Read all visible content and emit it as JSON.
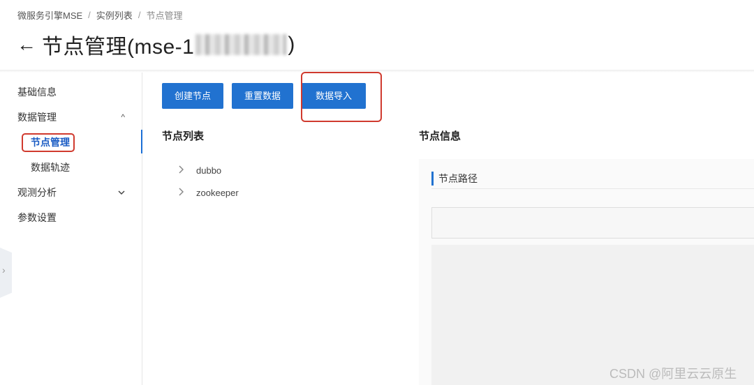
{
  "breadcrumb": {
    "items": [
      "微服务引擎MSE",
      "实例列表",
      "节点管理"
    ],
    "separator": "/"
  },
  "header": {
    "back_icon": "arrow-left-icon",
    "title_prefix": "节点管理(mse-1",
    "title_suffix": ")"
  },
  "sidebar": {
    "items": [
      {
        "label": "基础信息"
      },
      {
        "label": "数据管理",
        "expanded": true
      },
      {
        "label": "节点管理",
        "active": true
      },
      {
        "label": "数据轨迹"
      },
      {
        "label": "观测分析",
        "expanded": false
      },
      {
        "label": "参数设置"
      }
    ],
    "collapse_glyph": "^",
    "expand_glyph": "v"
  },
  "toolbar": {
    "create_label": "创建节点",
    "reset_label": "重置数据",
    "import_label": "数据导入"
  },
  "node_list": {
    "title": "节点列表",
    "items": [
      "dubbo",
      "zookeeper"
    ]
  },
  "node_info": {
    "title": "节点信息",
    "path_label": "节点路径",
    "path_value": ""
  },
  "watermark": "CSDN @阿里云云原生",
  "colors": {
    "primary": "#2172d0",
    "highlight": "#d03a2e"
  }
}
